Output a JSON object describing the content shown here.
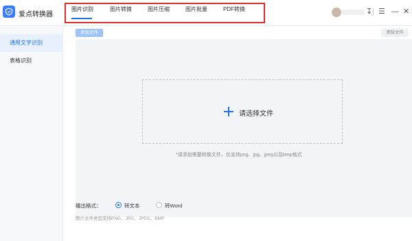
{
  "app": {
    "title": "爱点转换器",
    "accent": "#1a73e8",
    "logo_icon": "shield-icon"
  },
  "nav": {
    "tabs": [
      {
        "label": "图片识别"
      },
      {
        "label": "图片转换"
      },
      {
        "label": "图片压缩"
      },
      {
        "label": "图片批量"
      },
      {
        "label": "PDF转换"
      }
    ],
    "active": "图片识别"
  },
  "window": {
    "user_icon": "avatar",
    "controls": [
      "minimize-icon",
      "menu-icon",
      "min-icon",
      "close-icon"
    ]
  },
  "sidebar": {
    "items": [
      {
        "label": "通用文字识别"
      },
      {
        "label": "表格识别"
      }
    ],
    "active": "通用文字识别"
  },
  "toolbar": {
    "add_label": "添加文件",
    "clear_label": "清除文件"
  },
  "dropzone": {
    "label": "请选择文件",
    "hint": "*请添加需要转换文件，仅支持png、jpg、jpeg以及bmp格式"
  },
  "output": {
    "label": "输出格式：",
    "options": [
      {
        "label": "转文本",
        "checked": true
      },
      {
        "label": "转Word",
        "checked": false
      }
    ],
    "support": "图片文件类型支持PNG、JPG、JPEG、BMP"
  }
}
